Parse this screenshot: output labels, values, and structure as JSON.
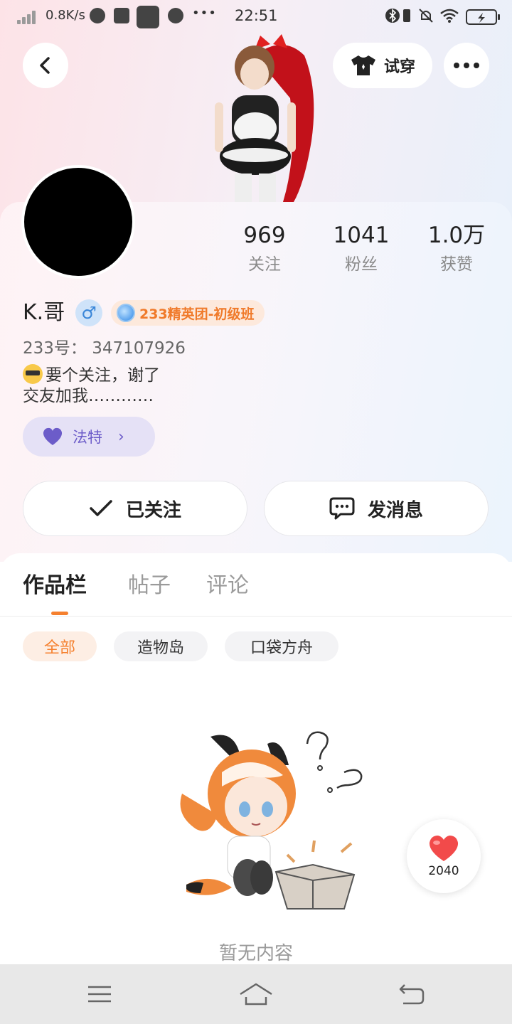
{
  "status_bar": {
    "speed": "0.8K/s",
    "time": "22:51",
    "more": "•••"
  },
  "header": {
    "try_on_label": "试穿"
  },
  "profile": {
    "stats": [
      {
        "value": "969",
        "label": "关注"
      },
      {
        "value": "1041",
        "label": "粉丝"
      },
      {
        "value": "1.0万",
        "label": "获赞"
      }
    ],
    "name": "K.哥",
    "gender_symbol": "♂",
    "badge": "233精英团-初级班",
    "uid": "233号： 347107926",
    "bio_line1": "要个关注，谢了",
    "bio_line2": "交友加我…………",
    "tag_label": "法特",
    "tag_chevron": "›"
  },
  "actions": {
    "following": "已关注",
    "message": "发消息"
  },
  "tabs": [
    "作品栏",
    "帖子",
    "评论"
  ],
  "filters": [
    "全部",
    "造物岛",
    "口袋方舟"
  ],
  "empty_text": "暂无内容",
  "like_count": "2040",
  "colors": {
    "accent": "#f5802e",
    "tag_purple": "#6c5cc9",
    "gender_blue": "#3a86d8",
    "like_red": "#f24a4a"
  }
}
